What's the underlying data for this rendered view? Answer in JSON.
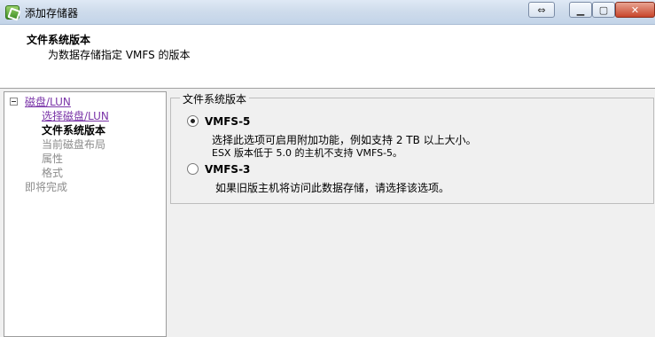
{
  "window": {
    "title": "添加存储器"
  },
  "header": {
    "title": "文件系统版本",
    "subtitle": "为数据存储指定 VMFS 的版本"
  },
  "nav": {
    "items": [
      {
        "label": "磁盘/LUN",
        "state": "link"
      },
      {
        "label": "选择磁盘/LUN",
        "state": "link"
      },
      {
        "label": "文件系统版本",
        "state": "active"
      },
      {
        "label": "当前磁盘布局",
        "state": "muted"
      },
      {
        "label": "属性",
        "state": "muted"
      },
      {
        "label": "格式",
        "state": "muted"
      },
      {
        "label": "即将完成",
        "state": "muted"
      }
    ]
  },
  "main": {
    "group_title": "文件系统版本",
    "options": [
      {
        "label": "VMFS-5",
        "selected": true,
        "desc1": "选择此选项可启用附加功能，例如支持 2 TB 以上大小。",
        "desc2": "ESX 版本低于 5.0 的主机不支持 VMFS-5。"
      },
      {
        "label": "VMFS-3",
        "selected": false,
        "desc1": "如果旧版主机将访问此数据存储，请选择该选项。"
      }
    ]
  },
  "icons": {
    "app": "vsphere-app-icon",
    "resize": "resize-icon",
    "minimize": "minimize-icon",
    "maximize": "maximize-icon",
    "close": "close-icon"
  }
}
